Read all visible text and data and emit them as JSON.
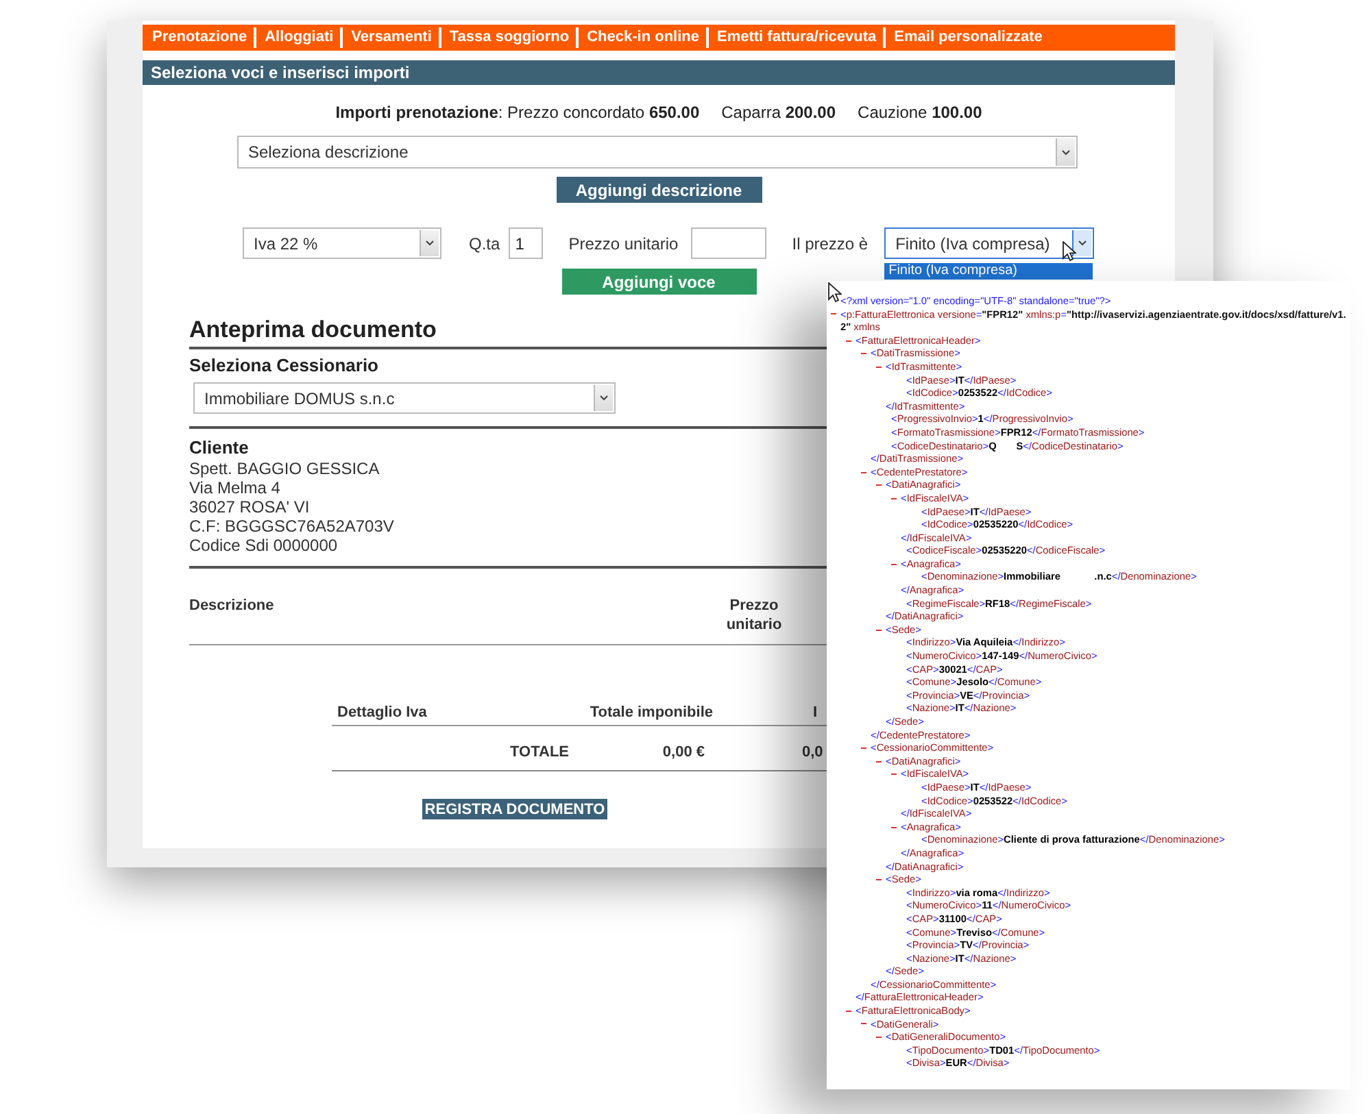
{
  "nav": {
    "items": [
      {
        "label": "Prenotazione"
      },
      {
        "label": "Alloggiati"
      },
      {
        "label": "Versamenti"
      },
      {
        "label": "Tassa soggiorno"
      },
      {
        "label": "Check-in online"
      },
      {
        "label": "Emetti fattura/ricevuta"
      },
      {
        "label": "Email personalizzate"
      }
    ]
  },
  "section_header": "Seleziona voci e inserisci importi",
  "booking_amounts": [
    "**Importi prenotazione**: Prezzo concordato **650.00**",
    "Caparra **200.00**",
    "Cauzione **100.00**"
  ],
  "form": {
    "description_select": {
      "value": "Seleziona descrizione"
    },
    "add_description_button": "Aggiungi descrizione",
    "vat_select": {
      "value": "Iva 22 %"
    },
    "qty": {
      "label": "Q.ta",
      "value": "1"
    },
    "unit_price": {
      "label": "Prezzo unitario"
    },
    "price_type": {
      "label": "Il prezzo è",
      "value": "Finito (Iva compresa)",
      "open": true,
      "options": [
        {
          "label": "Finito (Iva compresa)",
          "selected": true
        }
      ]
    },
    "add_item_button": "Aggiungi voce"
  },
  "preview": {
    "title": "Anteprima documento",
    "cessionario_label": "Seleziona Cessionario",
    "cessionario_select": {
      "value": "Immobiliare DOMUS s.n.c"
    },
    "client_heading": "Cliente",
    "client_lines": [
      "Spett. BAGGIO GESSICA",
      "Via Melma 4",
      "36027 ROSA' VI",
      "C.F: BGGGSC76A52A703V",
      "Codice Sdi 0000000"
    ],
    "items_columns": [
      "Descrizione",
      "Prezzo unitario"
    ],
    "vat_columns": [
      "Dettaglio Iva",
      "Totale imponibile",
      "I"
    ],
    "total_row": [
      "TOTALE",
      "0,00 €",
      "0,0"
    ],
    "register_button": "REGISTRA DOCUMENTO"
  },
  "xml": {
    "declaration": "<?xml version=\"1.0\" encoding=\"UTF-8\" standalone=\"true\"?>",
    "root": {
      "open": "<p:FatturaElettronica versione=\"FPR12\" xmlns:p=\"http://ivaservizi.agenziaentrate.gov.it/docs/xsd/fatture/v1.2\" xmlns",
      "expanded": true,
      "children": [
        {
          "open": "<FatturaElettronicaHeader>",
          "expanded": true,
          "close": "</FatturaElettronicaHeader>",
          "children": [
            {
              "open": "<DatiTrasmissione>",
              "expanded": true,
              "close": "</DatiTrasmissione>",
              "children": [
                {
                  "open": "<IdTrasmittente>",
                  "expanded": true,
                  "close": "</IdTrasmittente>",
                  "children": [
                    {
                      "open": "<IdPaese>",
                      "value": "IT",
                      "close": "</IdPaese>"
                    },
                    {
                      "open": "<IdCodice>",
                      "value": "0253522",
                      "close": "</IdCodice>"
                    }
                  ]
                },
                {
                  "open": "<ProgressivoInvio>",
                  "value": "1",
                  "close": "</ProgressivoInvio>"
                },
                {
                  "open": "<FormatoTrasmissione>",
                  "value": "FPR12",
                  "close": "</FormatoTrasmissione>"
                },
                {
                  "open": "<CodiceDestinatario>",
                  "value": "Q       S",
                  "close": "</CodiceDestinatario>"
                }
              ]
            },
            {
              "open": "<CedentePrestatore>",
              "expanded": true,
              "close": "</CedentePrestatore>",
              "children": [
                {
                  "open": "<DatiAnagrafici>",
                  "expanded": true,
                  "close": "</DatiAnagrafici>",
                  "children": [
                    {
                      "open": "<IdFiscaleIVA>",
                      "expanded": true,
                      "close": "</IdFiscaleIVA>",
                      "children": [
                        {
                          "open": "<IdPaese>",
                          "value": "IT",
                          "close": "</IdPaese>"
                        },
                        {
                          "open": "<IdCodice>",
                          "value": "02535220",
                          "close": "</IdCodice>"
                        }
                      ]
                    },
                    {
                      "open": "<CodiceFiscale>",
                      "value": "02535220",
                      "close": "</CodiceFiscale>"
                    },
                    {
                      "open": "<Anagrafica>",
                      "expanded": true,
                      "close": "</Anagrafica>",
                      "children": [
                        {
                          "open": "<Denominazione>",
                          "value": "Immobiliare            .n.c",
                          "close": "</Denominazione>"
                        }
                      ]
                    },
                    {
                      "open": "<RegimeFiscale>",
                      "value": "RF18",
                      "close": "</RegimeFiscale>"
                    }
                  ]
                },
                {
                  "open": "<Sede>",
                  "expanded": true,
                  "close": "</Sede>",
                  "children": [
                    {
                      "open": "<Indirizzo>",
                      "value": "Via Aquileia",
                      "close": "</Indirizzo>"
                    },
                    {
                      "open": "<NumeroCivico>",
                      "value": "147-149",
                      "close": "</NumeroCivico>"
                    },
                    {
                      "open": "<CAP>",
                      "value": "30021",
                      "close": "</CAP>"
                    },
                    {
                      "open": "<Comune>",
                      "value": "Jesolo",
                      "close": "</Comune>"
                    },
                    {
                      "open": "<Provincia>",
                      "value": "VE",
                      "close": "</Provincia>"
                    },
                    {
                      "open": "<Nazione>",
                      "value": "IT",
                      "close": "</Nazione>"
                    }
                  ]
                }
              ]
            },
            {
              "open": "<CessionarioCommittente>",
              "expanded": true,
              "close": "</CessionarioCommittente>",
              "children": [
                {
                  "open": "<DatiAnagrafici>",
                  "expanded": true,
                  "close": "</DatiAnagrafici>",
                  "children": [
                    {
                      "open": "<IdFiscaleIVA>",
                      "expanded": true,
                      "close": "</IdFiscaleIVA>",
                      "children": [
                        {
                          "open": "<IdPaese>",
                          "value": "IT",
                          "close": "</IdPaese>"
                        },
                        {
                          "open": "<IdCodice>",
                          "value": "0253522",
                          "close": "</IdCodice>"
                        }
                      ]
                    },
                    {
                      "open": "<Anagrafica>",
                      "expanded": true,
                      "close": "</Anagrafica>",
                      "children": [
                        {
                          "open": "<Denominazione>",
                          "value": "Cliente di prova fatturazione",
                          "close": "</Denominazione>"
                        }
                      ]
                    }
                  ]
                },
                {
                  "open": "<Sede>",
                  "expanded": true,
                  "close": "</Sede>",
                  "children": [
                    {
                      "open": "<Indirizzo>",
                      "value": "via roma",
                      "close": "</Indirizzo>"
                    },
                    {
                      "open": "<NumeroCivico>",
                      "value": "11",
                      "close": "</NumeroCivico>"
                    },
                    {
                      "open": "<CAP>",
                      "value": "31100",
                      "close": "</CAP>"
                    },
                    {
                      "open": "<Comune>",
                      "value": "Treviso",
                      "close": "</Comune>"
                    },
                    {
                      "open": "<Provincia>",
                      "value": "TV",
                      "close": "</Provincia>"
                    },
                    {
                      "open": "<Nazione>",
                      "value": "IT",
                      "close": "</Nazione>"
                    }
                  ]
                }
              ]
            }
          ]
        },
        {
          "open": "<FatturaElettronicaBody>",
          "expanded": true,
          "children": [
            {
              "open": "<DatiGenerali>",
              "expanded": true,
              "children": [
                {
                  "open": "<DatiGeneraliDocumento>",
                  "expanded": true,
                  "children": [
                    {
                      "open": "<TipoDocumento>",
                      "value": "TD01",
                      "close": "</TipoDocumento>"
                    },
                    {
                      "open": "<Divisa>",
                      "value": "EUR",
                      "close": "</Divisa>"
                    }
                  ]
                }
              ]
            }
          ]
        }
      ]
    }
  }
}
